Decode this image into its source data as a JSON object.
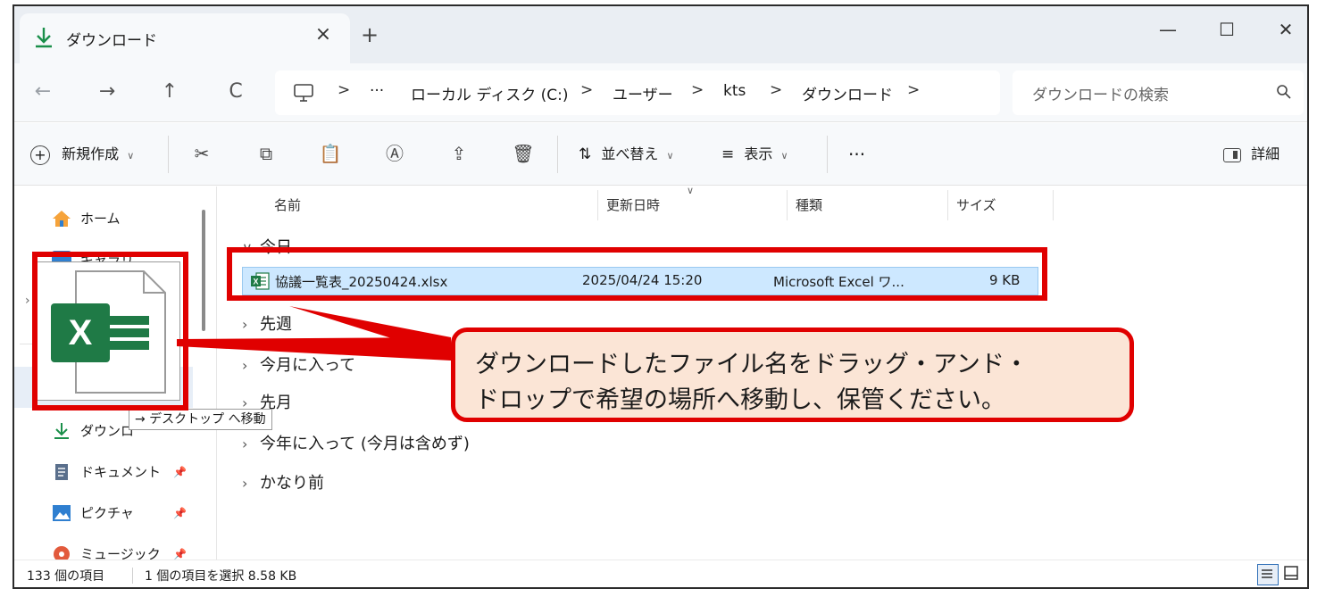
{
  "window": {
    "tab_title": "ダウンロード",
    "tab_close": "×",
    "new_tab": "+",
    "minimize": "—",
    "maximize": "☐",
    "close": "✕"
  },
  "address_bar": {
    "nav": {
      "back": "←",
      "forward": "→",
      "up": "↑",
      "refresh": "C"
    },
    "more": "···",
    "separator": ">",
    "crumbs": [
      "ローカル ディスク (C:)",
      "ユーザー",
      "kts",
      "ダウンロード"
    ],
    "search_placeholder": "ダウンロードの検索"
  },
  "command_bar": {
    "new": "新規作成",
    "sort": "並べ替え",
    "view": "表示",
    "more": "···",
    "details": "詳細"
  },
  "sidebar": {
    "items": [
      {
        "label": "ホーム",
        "icon": "home-icon"
      },
      {
        "label": "ギャラリ",
        "icon": "gallery-icon"
      },
      {
        "label": "ダウンロ",
        "icon": "download-icon"
      },
      {
        "label": "ドキュメント",
        "icon": "document-icon",
        "pinned": true
      },
      {
        "label": "ピクチャ",
        "icon": "picture-icon",
        "pinned": true
      },
      {
        "label": "ミュージック",
        "icon": "music-icon",
        "pinned": true
      }
    ]
  },
  "file_list": {
    "columns": [
      "名前",
      "更新日時",
      "種類",
      "サイズ"
    ],
    "groups": [
      {
        "label": "今日",
        "expanded": true
      },
      {
        "label": "先週",
        "expanded": false
      },
      {
        "label": "今月に入って",
        "expanded": false
      },
      {
        "label": "先月",
        "expanded": false
      },
      {
        "label": "今年に入って (今月は含めず)",
        "expanded": false
      },
      {
        "label": "かなり前",
        "expanded": false
      }
    ],
    "files": [
      {
        "name": "協議一覧表_20250424.xlsx",
        "modified": "2025/04/24 15:20",
        "type": "Microsoft Excel ワ...",
        "size": "9 KB",
        "selected": true
      }
    ]
  },
  "drag": {
    "tooltip": "→ デスクトップ へ移動"
  },
  "status_bar": {
    "item_count": "133 個の項目",
    "selection": "1 個の項目を選択  8.58 KB"
  },
  "annotation": {
    "line1": "ダウンロードしたファイル名をドラッグ・アンド・",
    "line2": "ドロップで希望の場所へ移動し、保管ください。",
    "color": "#e00000",
    "fill": "#fbe5d6"
  }
}
